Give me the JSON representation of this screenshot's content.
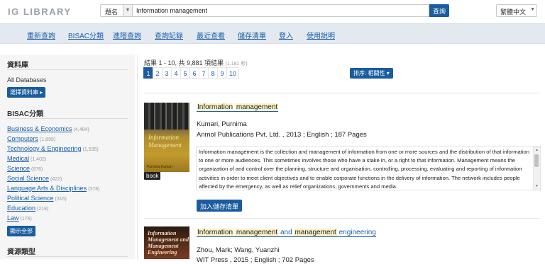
{
  "header": {
    "logo": "IG LIBRARY",
    "search_field_select": "題名",
    "search_value": "Information management",
    "search_button": "查詢",
    "language": "繁體中文"
  },
  "nav": [
    "重新查詢",
    "BISAC分類",
    "進階查詢",
    "查詢記錄",
    "最近查看",
    "儲存清單",
    "登入",
    "使用說明"
  ],
  "sidebar": {
    "db_heading": "資料庫",
    "db_value": "All Databases",
    "db_button": "選擇資料庫",
    "bisac_heading": "BISAC分類",
    "bisac_items": [
      {
        "label": "Business & Economics",
        "count": "(4,484)"
      },
      {
        "label": "Computers",
        "count": "(1,895)"
      },
      {
        "label": "Technology & Engineering",
        "count": "(1,535)"
      },
      {
        "label": "Medical",
        "count": "(1,402)"
      },
      {
        "label": "Science",
        "count": "(876)"
      },
      {
        "label": "Social Science",
        "count": "(422)"
      },
      {
        "label": "Language Arts & Disciplines",
        "count": "(378)"
      },
      {
        "label": "Political Science",
        "count": "(316)"
      },
      {
        "label": "Education",
        "count": "(218)"
      },
      {
        "label": "Law",
        "count": "(176)"
      }
    ],
    "show_all_button": "顯示全部",
    "type_heading": "資源類型"
  },
  "results": {
    "summary": "結果 1 - 10, 共 9,881 項結果",
    "time": "(1.181 秒)",
    "pages": [
      "1",
      "2",
      "3",
      "4",
      "5",
      "6",
      "7",
      "8",
      "9",
      "10"
    ],
    "active_page": "1",
    "sort_button": "排序: 相關性"
  },
  "records": [
    {
      "title_words": [
        "Information",
        "management"
      ],
      "cover_title": "Information Management",
      "cover_author": "Purnima Kumari",
      "author": "Kumari, Purnima",
      "publisher_line": "Anmol Publications Pvt. Ltd. , 2013 ; English ; 187 Pages",
      "type_badge": "book",
      "abstract": "Information management is the collection and management of information from one or more sources and the distribution of that information to one or more audiences. This sometimes involves those who have a stake in, or a right to that information. Management means the organization of and control over the planning, structure and organisation, controlling, processing, evaluating and reporting of information activities in order to meet client objectives and to enable corporate functions in the delivery of information. The network includes people affected by the emergency, as well as relief organizations, governments and media.",
      "add_button": "加入儲存清單"
    },
    {
      "title_parts": [
        "Information",
        "management",
        "and",
        "management",
        "engineering"
      ],
      "cover_title": "Information Management and Management Engineering",
      "author": "Zhou, Mark; Wang, Yuanzhi",
      "publisher_line": "WIT Press , 2015 ; English ; 702 Pages"
    }
  ]
}
